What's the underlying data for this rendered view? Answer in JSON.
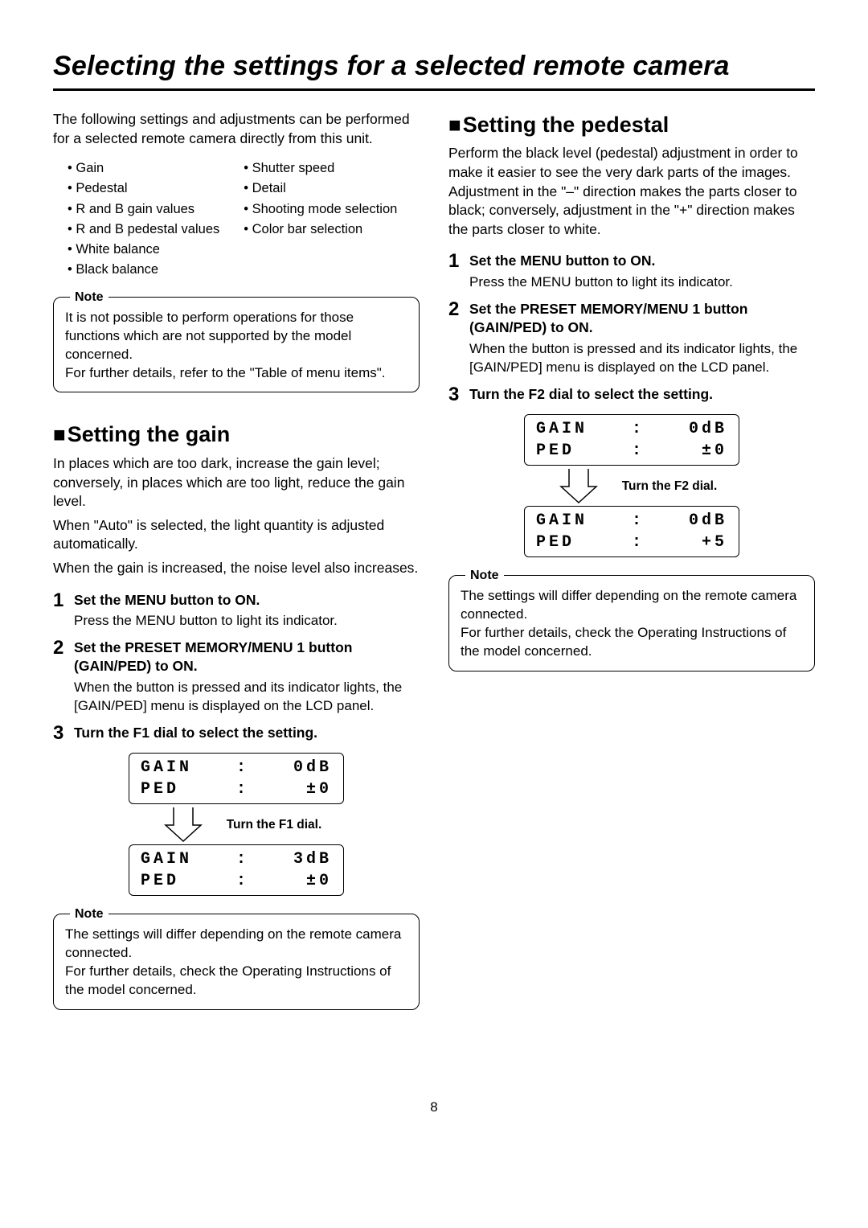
{
  "page_number": "8",
  "title": "Selecting the settings for a selected remote camera",
  "intro": "The following settings and adjustments can be performed for a selected remote camera directly from this unit.",
  "settings_left": [
    "Gain",
    "Pedestal",
    "R and B gain values",
    "R and B pedestal values",
    "White balance",
    "Black balance"
  ],
  "settings_right": [
    "Shutter speed",
    "Detail",
    "Shooting mode selection",
    "Color bar selection"
  ],
  "note1_label": "Note",
  "note1_line1": "It is not possible to perform operations for those functions which are not supported by the model concerned.",
  "note1_line2": "For further details, refer to the \"Table of menu items\".",
  "gain": {
    "heading": "Setting the gain",
    "intro_a": "In places which are too dark, increase the gain level; conversely, in places which are too light, reduce the gain level.",
    "intro_b": "When \"Auto\" is selected, the light quantity is adjusted automatically.",
    "intro_c": "When the gain is increased, the noise level also increases.",
    "steps": {
      "1": {
        "title": "Set the MENU button to ON.",
        "text": "Press the MENU button to light its indicator."
      },
      "2": {
        "title": "Set the PRESET MEMORY/MENU 1 button (GAIN/PED) to ON.",
        "text": "When the button is pressed and its indicator lights, the [GAIN/PED] menu is displayed on the LCD panel."
      },
      "3": {
        "title": "Turn the F1 dial to select the setting."
      }
    },
    "lcd_before": {
      "gain_l": "GAIN",
      "gain_v": "0dB",
      "ped_l": "PED",
      "ped_v": "±0"
    },
    "arrow_caption": "Turn the F1 dial.",
    "lcd_after": {
      "gain_l": "GAIN",
      "gain_v": "3dB",
      "ped_l": "PED",
      "ped_v": "±0"
    },
    "note_label": "Note",
    "note_line1": "The settings will differ depending on the remote camera connected.",
    "note_line2": "For further details, check the Operating Instructions of the model concerned."
  },
  "pedestal": {
    "heading": "Setting the pedestal",
    "intro": "Perform the black level (pedestal) adjustment in order to make it easier to see the very dark parts of the images. Adjustment in the \"–\" direction makes the parts closer to black; conversely, adjustment in the \"+\" direction makes the parts closer to white.",
    "steps": {
      "1": {
        "title": "Set the MENU button to ON.",
        "text": "Press the MENU button to light its indicator."
      },
      "2": {
        "title": "Set the PRESET MEMORY/MENU 1 button (GAIN/PED) to ON.",
        "text": "When the button is pressed and its indicator lights, the [GAIN/PED] menu is displayed on the LCD panel."
      },
      "3": {
        "title": "Turn the F2 dial to select the setting."
      }
    },
    "lcd_before": {
      "gain_l": "GAIN",
      "gain_v": "0dB",
      "ped_l": "PED",
      "ped_v": "±0"
    },
    "arrow_caption": "Turn the F2 dial.",
    "lcd_after": {
      "gain_l": "GAIN",
      "gain_v": "0dB",
      "ped_l": "PED",
      "ped_v": "+5"
    },
    "note_label": "Note",
    "note_line1": "The settings will differ depending on the remote camera connected.",
    "note_line2": "For further details, check the Operating Instructions of the model concerned."
  }
}
